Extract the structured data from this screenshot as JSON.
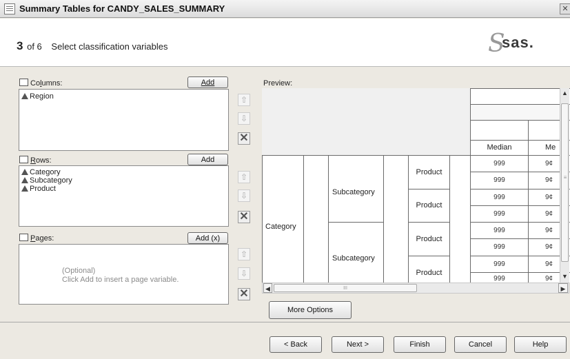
{
  "window": {
    "title": "Summary Tables for CANDY_SALES_SUMMARY",
    "close_glyph": "✕"
  },
  "header": {
    "step_num": "3",
    "step_of": "of 6",
    "step_title": "Select classification variables",
    "logo": "sas."
  },
  "columns": {
    "label_pre": "Co",
    "label_u": "l",
    "label_post": "umns:",
    "add_button": "Add",
    "items": [
      "Region"
    ]
  },
  "rows": {
    "label_u": "R",
    "label_post": "ows:",
    "add_button": "Add",
    "items": [
      "Category",
      "Subcategory",
      "Product"
    ]
  },
  "pages": {
    "label_u": "P",
    "label_post": "ages:",
    "add_button": "Add (x)",
    "placeholder_line1": "(Optional)",
    "placeholder_line2": "Click Add to insert a page variable."
  },
  "side_buttons": {
    "up": "⇧",
    "down": "⇩",
    "remove": "✕"
  },
  "preview": {
    "label": "Preview:",
    "header_stat": [
      "Median",
      "Me"
    ],
    "row_labels": {
      "category": "Category",
      "subcategory": "Subcategory",
      "product": "Product"
    },
    "values": [
      "999",
      "999",
      "999",
      "999",
      "999",
      "999",
      "999",
      "999"
    ],
    "values_cut": [
      "9¢",
      "9¢",
      "9¢",
      "9¢",
      "9¢",
      "9¢",
      "9¢",
      "9¢"
    ],
    "hscroll_thumb": "III",
    "vscroll_mark": "≡"
  },
  "more_options": "More Options",
  "footer": {
    "back": "< Back",
    "next": "Next >",
    "finish": "Finish",
    "cancel": "Cancel",
    "help": "Help"
  }
}
